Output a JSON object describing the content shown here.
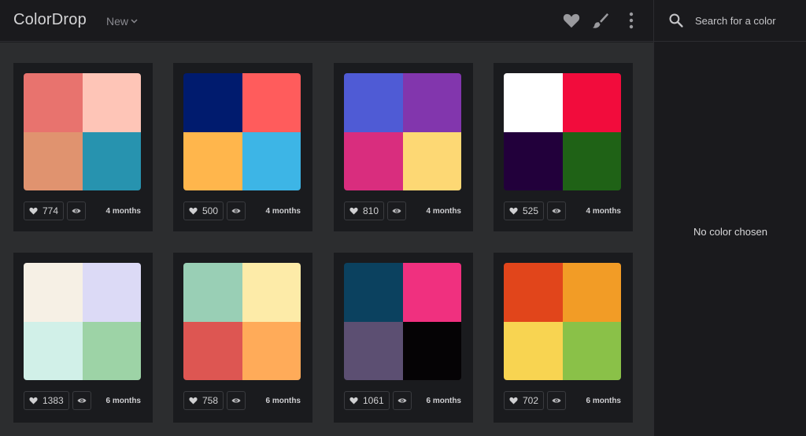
{
  "app": {
    "title": "ColorDrop"
  },
  "header": {
    "filter_label": "New"
  },
  "search": {
    "placeholder": "Search for a color",
    "value": ""
  },
  "sidebar": {
    "empty_text": "No color chosen"
  },
  "colors": {
    "accent": "#2b2c2f"
  },
  "palettes": [
    {
      "colors": [
        "#e8736e",
        "#fec5b7",
        "#e0936f",
        "#2793af"
      ],
      "likes": "774",
      "age": "4 months"
    },
    {
      "colors": [
        "#001b6e",
        "#ff5c5c",
        "#ffb64c",
        "#3db5e6"
      ],
      "likes": "500",
      "age": "4 months"
    },
    {
      "colors": [
        "#4f5bd5",
        "#8236ad",
        "#d92d7e",
        "#fdd874"
      ],
      "likes": "810",
      "age": "4 months"
    },
    {
      "colors": [
        "#ffffff",
        "#f20c3c",
        "#22003b",
        "#1f6216"
      ],
      "likes": "525",
      "age": "4 months"
    },
    {
      "colors": [
        "#f6f0e5",
        "#dcdaf6",
        "#d1f0e8",
        "#9dd3a6"
      ],
      "likes": "1383",
      "age": "6 months"
    },
    {
      "colors": [
        "#99cfb5",
        "#fdeba8",
        "#dd5652",
        "#ffab59"
      ],
      "likes": "758",
      "age": "6 months"
    },
    {
      "colors": [
        "#0b415f",
        "#f0307f",
        "#5c4f72",
        "#050305"
      ],
      "likes": "1061",
      "age": "6 months"
    },
    {
      "colors": [
        "#e1451b",
        "#f29c26",
        "#f8d451",
        "#8ac148"
      ],
      "likes": "702",
      "age": "6 months"
    }
  ]
}
